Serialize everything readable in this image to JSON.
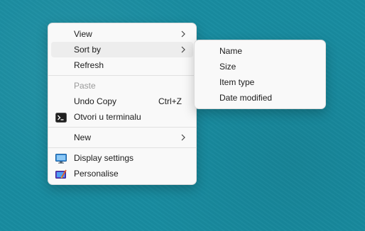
{
  "context_menu": {
    "items": [
      {
        "label": "View"
      },
      {
        "label": "Sort by"
      },
      {
        "label": "Refresh"
      },
      {
        "label": "Paste"
      },
      {
        "label": "Undo Copy",
        "shortcut": "Ctrl+Z"
      },
      {
        "label": "Otvori u terminalu",
        "icon": "terminal-icon"
      },
      {
        "label": "New"
      },
      {
        "label": "Display settings",
        "icon": "display-icon"
      },
      {
        "label": "Personalise",
        "icon": "personalise-icon"
      }
    ]
  },
  "sort_submenu": {
    "items": [
      {
        "label": "Name"
      },
      {
        "label": "Size"
      },
      {
        "label": "Item type"
      },
      {
        "label": "Date modified"
      }
    ]
  },
  "colors": {
    "desktop": "#188ca0",
    "menu_bg": "#f9f9f9",
    "hover_bg": "#ededed",
    "disabled_text": "#9a9a9a"
  }
}
